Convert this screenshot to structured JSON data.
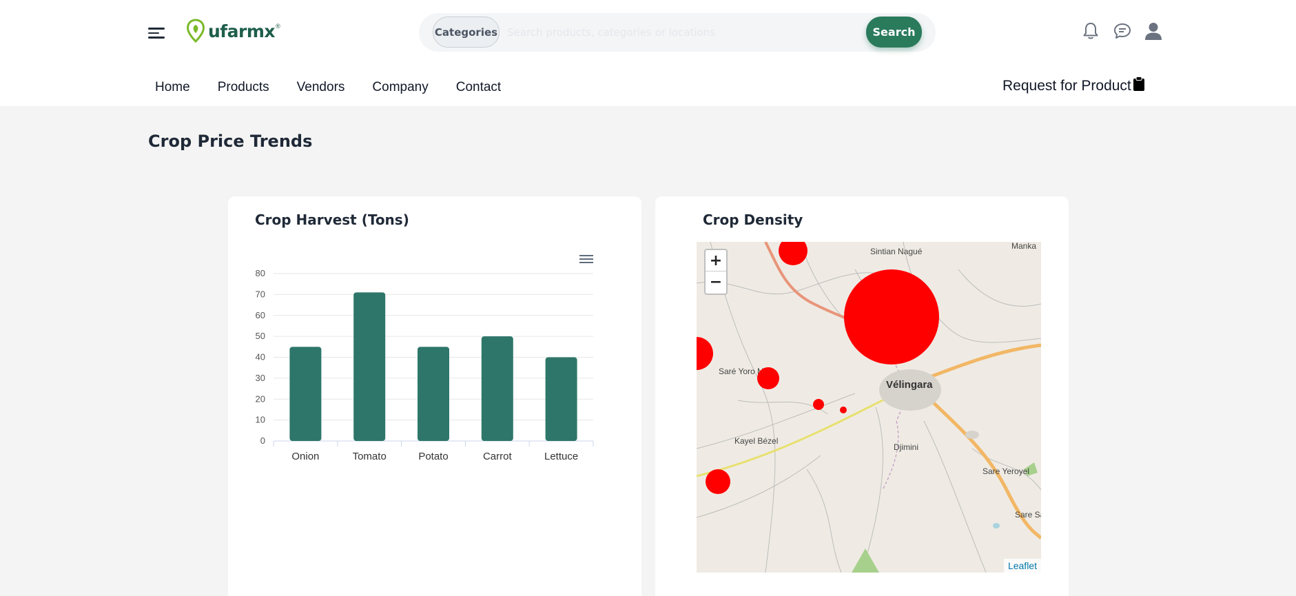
{
  "header": {
    "brand": "ufarmx",
    "brand_mark": "®",
    "categories_label": "Categories",
    "search_placeholder": "Search products, categories or locations",
    "search_label": "Search",
    "icons": [
      "menu-icon",
      "bell-icon",
      "chat-icon",
      "user-icon"
    ]
  },
  "nav": {
    "items": [
      "Home",
      "Products",
      "Vendors",
      "Company",
      "Contact"
    ],
    "request_label": "Request for Product"
  },
  "page": {
    "title": "Crop Price Trends"
  },
  "harvest_card": {
    "title": "Crop Harvest (Tons)"
  },
  "density_card": {
    "title": "Crop Density",
    "zoom_in": "+",
    "zoom_out": "−",
    "attribution": "Leaflet",
    "places": [
      "Sintian Nagué",
      "Saré Yoro Mbia",
      "Vélingara",
      "Kayel Bézel",
      "Djimini",
      "Sare Yeroyel",
      "Sare Sav",
      "Manka"
    ]
  },
  "colors": {
    "brand": "#1e5e4b",
    "accent": "#2a7a5c",
    "bar": "#2e766a",
    "marker": "#ff0000"
  },
  "chart_data": {
    "type": "bar",
    "title": "Crop Harvest (Tons)",
    "categories": [
      "Onion",
      "Tomato",
      "Potato",
      "Carrot",
      "Lettuce"
    ],
    "values": [
      45,
      71,
      45,
      50,
      40
    ],
    "y_ticks": [
      0,
      10,
      20,
      30,
      40,
      50,
      60,
      70,
      80
    ],
    "ylim": [
      0,
      80
    ],
    "grid": true
  }
}
